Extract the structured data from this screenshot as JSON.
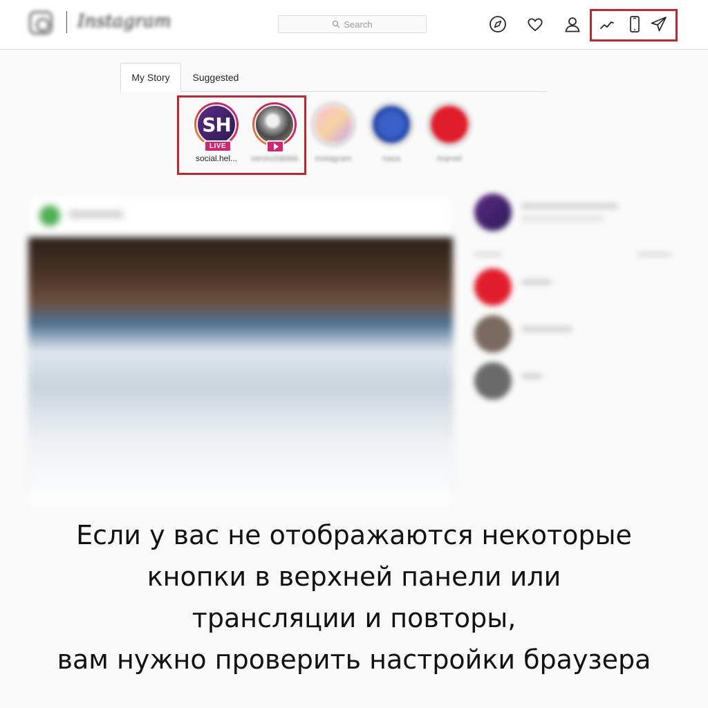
{
  "header": {
    "logo_text": "Instagram",
    "search_placeholder": "Search",
    "icons": [
      "compass-icon",
      "heart-icon",
      "profile-icon",
      "stats-icon",
      "mobile-icon",
      "direct-send-icon"
    ]
  },
  "stories": {
    "tabs": [
      {
        "label": "My Story"
      },
      {
        "label": "Suggested"
      }
    ],
    "items": [
      {
        "label": "social.hel...",
        "badge": "LIVE",
        "avatar_text": "SH"
      },
      {
        "label": "veronchikkkk",
        "badge": "play"
      },
      {
        "label": "instagram"
      },
      {
        "label": "nasa"
      },
      {
        "label": "marvel"
      }
    ]
  },
  "caption": {
    "line1": "Если у вас не отображаются некоторые",
    "line2": "кнопки в верхней панели или",
    "line3": "трансляции и повторы,",
    "line4": "вам нужно проверить настройки браузера"
  },
  "colors": {
    "highlight": "#c1272d",
    "live_badge": "#d6246e"
  }
}
